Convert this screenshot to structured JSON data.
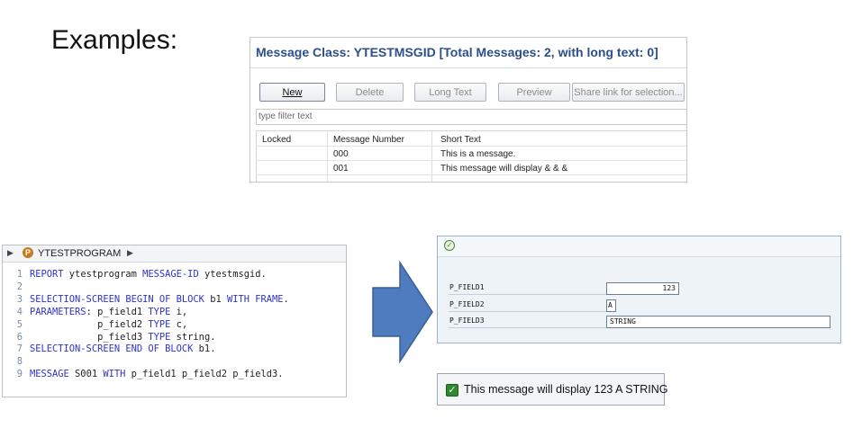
{
  "heading": "Examples:",
  "message_class": {
    "title": "Message Class: YTESTMSGID [Total Messages: 2, with long text: 0]",
    "buttons": {
      "new": "New",
      "delete": "Delete",
      "long_text": "Long Text",
      "preview": "Preview",
      "share": "Share link for selection..."
    },
    "filter_placeholder": "type filter text",
    "columns": [
      "Locked",
      "Message Number",
      "Short Text"
    ],
    "rows": [
      {
        "locked": "",
        "number": "000",
        "text": "This is a message."
      },
      {
        "locked": "",
        "number": "001",
        "text": "This message will display & & &"
      }
    ]
  },
  "editor": {
    "breadcrumb": {
      "arrow_left": "▶",
      "badge": "P",
      "program": "YTESTPROGRAM",
      "arrow_right": "▶"
    },
    "lines": [
      {
        "n": "1",
        "kw1": "REPORT",
        "t1": " ytestprogram ",
        "kw2": "MESSAGE-ID",
        "t2": " ytestmsgid."
      },
      {
        "n": "2",
        "kw1": "",
        "t1": "",
        "kw2": "",
        "t2": ""
      },
      {
        "n": "3",
        "kw1": "SELECTION-SCREEN BEGIN OF BLOCK",
        "t1": " b1 ",
        "kw2": "WITH FRAME",
        "t2": "."
      },
      {
        "n": "4",
        "kw1": "PARAMETERS",
        "t1": ": p_field1 ",
        "kw2": "TYPE",
        "t2": " i,"
      },
      {
        "n": "5",
        "kw1": "",
        "t1": "            p_field2 ",
        "kw2": "TYPE",
        "t2": " c,"
      },
      {
        "n": "6",
        "kw1": "",
        "t1": "            p_field3 ",
        "kw2": "TYPE",
        "t2": " string."
      },
      {
        "n": "7",
        "kw1": "SELECTION-SCREEN END OF BLOCK",
        "t1": " b1.",
        "kw2": "",
        "t2": ""
      },
      {
        "n": "8",
        "kw1": "",
        "t1": "",
        "kw2": "",
        "t2": ""
      },
      {
        "n": "9",
        "kw1": "MESSAGE",
        "t1": " S001 ",
        "kw2": "WITH",
        "t2": " p_field1 p_field2 p_field3."
      }
    ]
  },
  "selection_screen": {
    "fields": [
      {
        "label": "P_FIELD1",
        "value": "123"
      },
      {
        "label": "P_FIELD2",
        "value": "A"
      },
      {
        "label": "P_FIELD3",
        "value": "STRING"
      }
    ]
  },
  "status": {
    "text": "This message will display 123 A STRING"
  },
  "colors": {
    "title_blue": "#2b4e8c",
    "keyword_blue": "#2c33c9",
    "arrow_fill": "#4f7bbf",
    "success_green": "#2f8a2f"
  }
}
